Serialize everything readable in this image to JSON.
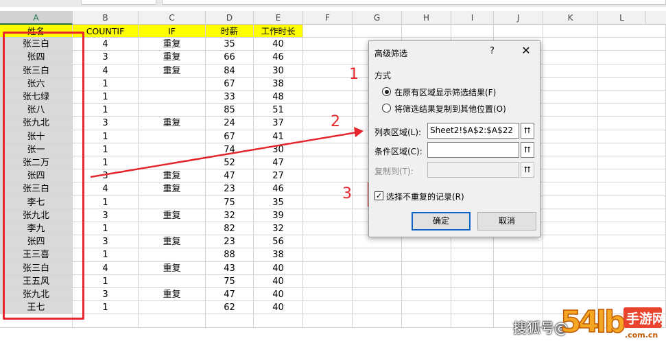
{
  "columns": [
    "A",
    "B",
    "C",
    "D",
    "E",
    "F",
    "G",
    "H",
    "I",
    "J",
    "K",
    "L"
  ],
  "table": {
    "headers": [
      "姓名",
      "COUNTIF",
      "IF",
      "时薪",
      "工作时长"
    ],
    "rows": [
      [
        "张三白",
        "4",
        "重复",
        "35",
        "40"
      ],
      [
        "张四",
        "3",
        "重复",
        "66",
        "46"
      ],
      [
        "张三白",
        "4",
        "重复",
        "84",
        "30"
      ],
      [
        "张六",
        "1",
        "",
        "67",
        "38"
      ],
      [
        "张七绿",
        "1",
        "",
        "33",
        "48"
      ],
      [
        "张八",
        "1",
        "",
        "85",
        "51"
      ],
      [
        "张九北",
        "3",
        "重复",
        "24",
        "37"
      ],
      [
        "张十",
        "1",
        "",
        "67",
        "41"
      ],
      [
        "张一",
        "1",
        "",
        "74",
        "30"
      ],
      [
        "张二万",
        "1",
        "",
        "52",
        "47"
      ],
      [
        "张四",
        "3",
        "重复",
        "47",
        "27"
      ],
      [
        "张三白",
        "4",
        "重复",
        "23",
        "46"
      ],
      [
        "李七",
        "1",
        "",
        "75",
        "35"
      ],
      [
        "张九北",
        "3",
        "重复",
        "32",
        "39"
      ],
      [
        "李九",
        "1",
        "",
        "82",
        "32"
      ],
      [
        "张四",
        "3",
        "重复",
        "23",
        "56"
      ],
      [
        "王三喜",
        "1",
        "",
        "88",
        "38"
      ],
      [
        "张三白",
        "4",
        "重复",
        "43",
        "40"
      ],
      [
        "王五风",
        "1",
        "",
        "75",
        "40"
      ],
      [
        "张九北",
        "3",
        "重复",
        "47",
        "40"
      ],
      [
        "王七",
        "1",
        "",
        "62",
        "40"
      ]
    ]
  },
  "annotations": {
    "step1": "1",
    "step2": "2",
    "step3": "3"
  },
  "dialog": {
    "title": "高级筛选",
    "help": "?",
    "close": "✕",
    "mode_label": "方式",
    "option_in_place": "在原有区域显示筛选结果(F)",
    "option_copy": "将筛选结果复制到其他位置(O)",
    "list_range_label": "列表区域(L):",
    "list_range_value": "Sheet2!$A$2:$A$22",
    "criteria_label": "条件区域(C):",
    "criteria_value": "",
    "copy_to_label": "复制到(T):",
    "copy_to_value": "",
    "unique_label": "选择不重复的记录(R)",
    "unique_checked": "✓",
    "ok_label": "确定",
    "cancel_label": "取消",
    "picker_glyph": "⮅"
  },
  "watermark": {
    "text": "搜狐号@"
  },
  "colors": {
    "header_yellow": "#ffff00",
    "annotation_red": "#e5262c",
    "selection_green": "#217346",
    "name_column_gray": "#d9d9d9"
  }
}
